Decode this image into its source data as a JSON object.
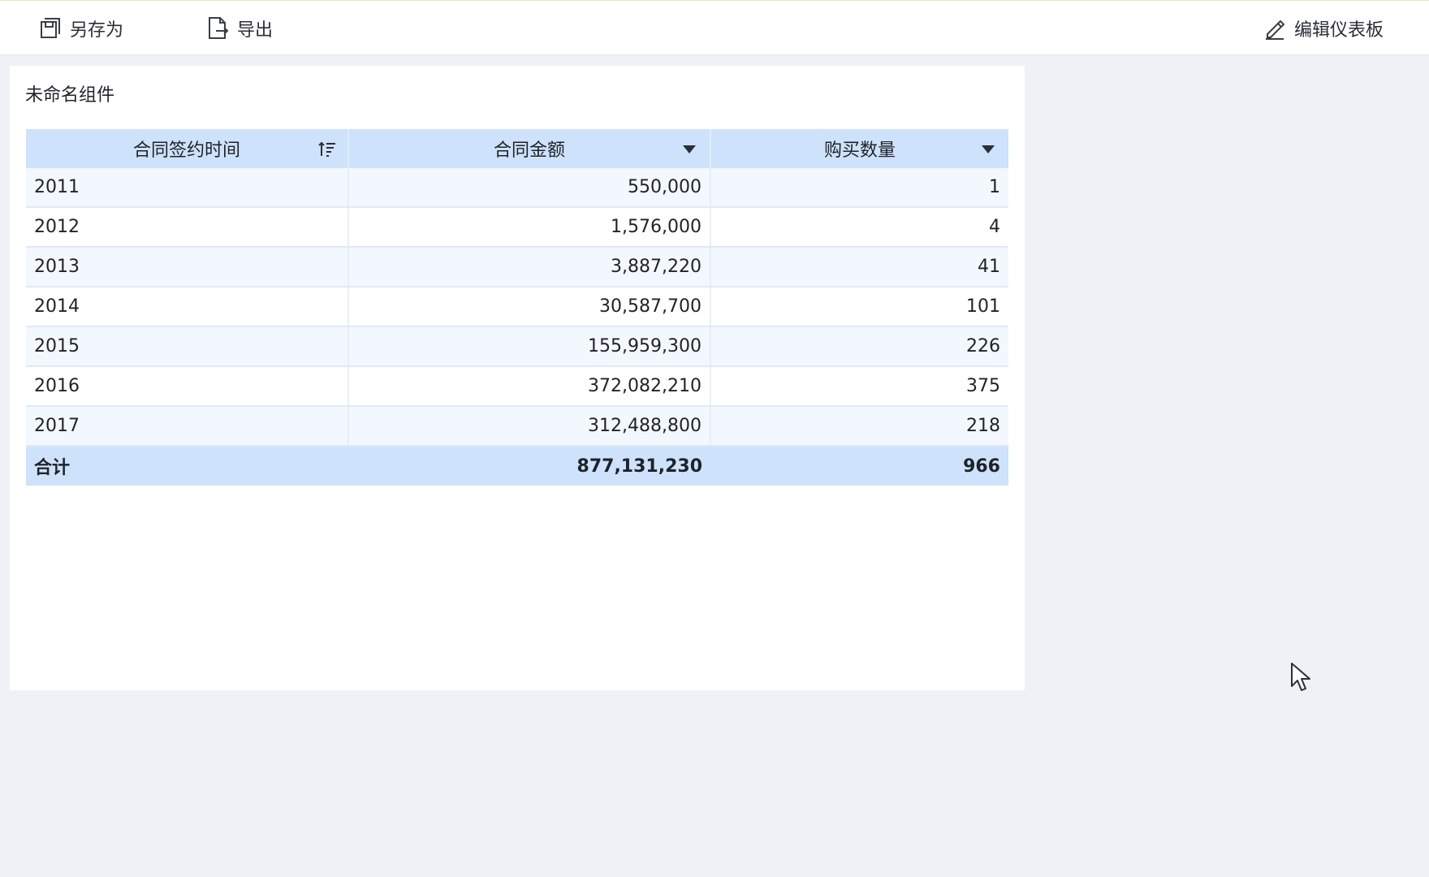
{
  "toolbar": {
    "save_as_label": "另存为",
    "export_label": "导出",
    "edit_dashboard_label": "编辑仪表板"
  },
  "widget": {
    "title": "未命名组件",
    "columns": [
      "合同签约时间",
      "合同金额",
      "购买数量"
    ],
    "rows": [
      [
        "2011",
        "550,000",
        "1"
      ],
      [
        "2012",
        "1,576,000",
        "4"
      ],
      [
        "2013",
        "3,887,220",
        "41"
      ],
      [
        "2014",
        "30,587,700",
        "101"
      ],
      [
        "2015",
        "155,959,300",
        "226"
      ],
      [
        "2016",
        "372,082,210",
        "375"
      ],
      [
        "2017",
        "312,488,800",
        "218"
      ]
    ],
    "total": {
      "label": "合计",
      "amount": "877,131,230",
      "quantity": "966"
    }
  },
  "icons": {
    "save": "save-icon",
    "export": "export-icon",
    "edit": "pencil-icon",
    "sort": "sort-ascending-icon",
    "dropdown": "caret-down-icon",
    "cursor": "mouse-pointer-icon"
  },
  "colors": {
    "header_bg": "#cfe2fb",
    "row_alt_bg": "#f3f8fe",
    "page_bg": "#eef2f7"
  }
}
